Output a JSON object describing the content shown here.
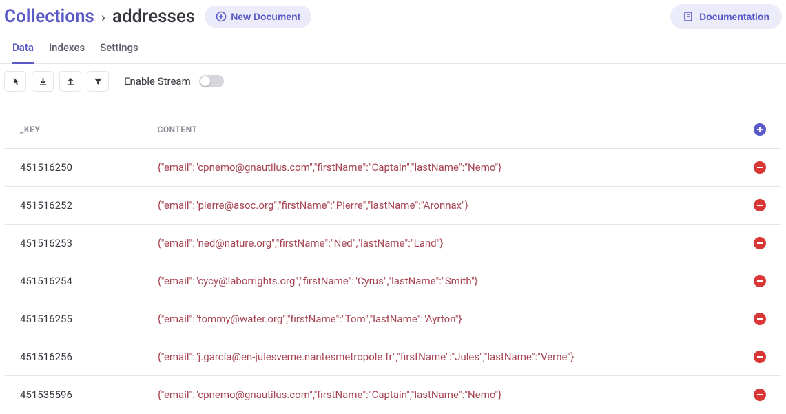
{
  "header": {
    "breadcrumb_root": "Collections",
    "breadcrumb_current": "addresses",
    "new_document_label": "New Document",
    "documentation_label": "Documentation"
  },
  "tabs": [
    {
      "label": "Data",
      "active": true
    },
    {
      "label": "Indexes",
      "active": false
    },
    {
      "label": "Settings",
      "active": false
    }
  ],
  "toolbar": {
    "enable_stream_label": "Enable Stream",
    "stream_enabled": false
  },
  "table": {
    "columns": {
      "key": "_KEY",
      "content": "CONTENT"
    },
    "rows": [
      {
        "key": "451516250",
        "content": "{\"email\":\"cpnemo@gnautilus.com\",\"firstName\":\"Captain\",\"lastName\":\"Nemo\"}"
      },
      {
        "key": "451516252",
        "content": "{\"email\":\"pierre@asoc.org\",\"firstName\":\"Pierre\",\"lastName\":\"Aronnax\"}"
      },
      {
        "key": "451516253",
        "content": "{\"email\":\"ned@nature.org\",\"firstName\":\"Ned\",\"lastName\":\"Land\"}"
      },
      {
        "key": "451516254",
        "content": "{\"email\":\"cycy@laborrights.org\",\"firstName\":\"Cyrus\",\"lastName\":\"Smith\"}"
      },
      {
        "key": "451516255",
        "content": "{\"email\":\"tommy@water.org\",\"firstName\":\"Tom\",\"lastName\":\"Ayrton\"}"
      },
      {
        "key": "451516256",
        "content": "{\"email\":\"j.garcia@en-julesverne.nantesmetropole.fr\",\"firstName\":\"Jules\",\"lastName\":\"Verne\"}"
      },
      {
        "key": "451535596",
        "content": "{\"email\":\"cpnemo@gnautilus.com\",\"firstName\":\"Captain\",\"lastName\":\"Nemo\"}"
      }
    ]
  }
}
